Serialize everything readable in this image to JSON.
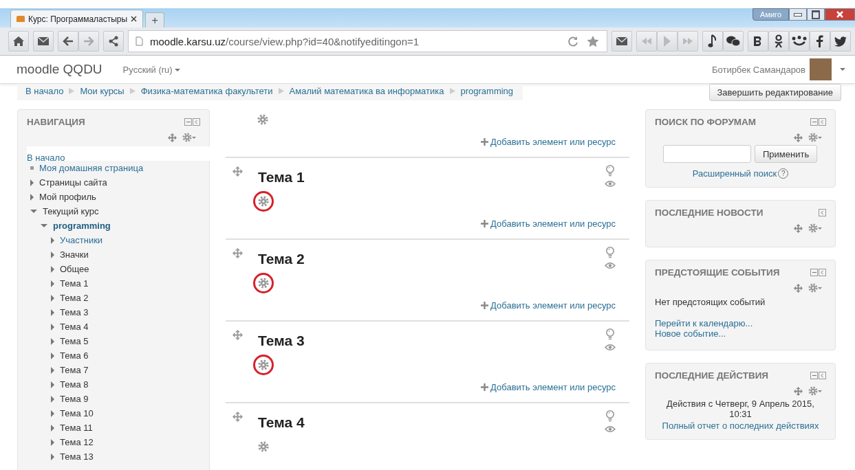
{
  "browser": {
    "tab_title": "Курс: Программаластыры",
    "new_tab": "+",
    "profile_button": "Амиго",
    "url_host": "moodle.karsu.uz",
    "url_path": "/course/view.php?id=40&notifyeditingon=1"
  },
  "header": {
    "brand": "moodle QQDU",
    "language": "Русский (ru)",
    "user_name": "Ботирбек Самандаров"
  },
  "breadcrumb": [
    "В начало",
    "Мои курсы",
    "Физика-математика факультети",
    "Амалий математика ва информатика",
    "programming"
  ],
  "edit_button": "Завершить редактирование",
  "navigation": {
    "title": "НАВИГАЦИЯ",
    "items": [
      {
        "label": "В начало",
        "kind": "root",
        "link": true
      },
      {
        "label": "Моя домашняя страница",
        "kind": "leaf",
        "link": true
      },
      {
        "label": "Страницы сайта",
        "kind": "branch",
        "link": false,
        "expanded": false
      },
      {
        "label": "Мой профиль",
        "kind": "branch",
        "link": false,
        "expanded": false
      },
      {
        "label": "Текущий курс",
        "kind": "branch",
        "link": false,
        "expanded": true,
        "children": [
          {
            "label": "programming",
            "kind": "course",
            "link": true,
            "expanded": true,
            "children": [
              {
                "label": "Участники",
                "kind": "branch",
                "link": true,
                "expanded": false
              },
              {
                "label": "Значки",
                "kind": "branch",
                "link": false,
                "expanded": false
              },
              {
                "label": "Общее",
                "kind": "branch",
                "link": false,
                "expanded": false
              },
              {
                "label": "Тема 1",
                "kind": "branch",
                "link": false,
                "expanded": false
              },
              {
                "label": "Тема 2",
                "kind": "branch",
                "link": false,
                "expanded": false
              },
              {
                "label": "Тема 3",
                "kind": "branch",
                "link": false,
                "expanded": false
              },
              {
                "label": "Тема 4",
                "kind": "branch",
                "link": false,
                "expanded": false
              },
              {
                "label": "Тема 5",
                "kind": "branch",
                "link": false,
                "expanded": false
              },
              {
                "label": "Тема 6",
                "kind": "branch",
                "link": false,
                "expanded": false
              },
              {
                "label": "Тема 7",
                "kind": "branch",
                "link": false,
                "expanded": false
              },
              {
                "label": "Тема 8",
                "kind": "branch",
                "link": false,
                "expanded": false
              },
              {
                "label": "Тема 9",
                "kind": "branch",
                "link": false,
                "expanded": false
              },
              {
                "label": "Тема 10",
                "kind": "branch",
                "link": false,
                "expanded": false
              },
              {
                "label": "Тема 11",
                "kind": "branch",
                "link": false,
                "expanded": false
              },
              {
                "label": "Тема 12",
                "kind": "branch",
                "link": false,
                "expanded": false
              },
              {
                "label": "Тема 13",
                "kind": "branch",
                "link": false,
                "expanded": false
              }
            ]
          }
        ]
      }
    ]
  },
  "sections": [
    {
      "add_link": "Добавить элемент или ресурс",
      "highlighted": false
    },
    {
      "title": "Тема 1",
      "add_link": "Добавить элемент или ресурс",
      "highlighted": true
    },
    {
      "title": "Тема 2",
      "add_link": "Добавить элемент или ресурс",
      "highlighted": true
    },
    {
      "title": "Тема 3",
      "add_link": "Добавить элемент или ресурс",
      "highlighted": true
    },
    {
      "title": "Тема 4",
      "highlighted": false
    }
  ],
  "blocks": [
    {
      "kind": "search",
      "title": "ПОИСК ПО ФОРУМАМ",
      "collapsible": true,
      "button": "Применить",
      "link": "Расширенный поиск",
      "help": "?"
    },
    {
      "kind": "empty",
      "title": "ПОСЛЕДНИЕ НОВОСТИ",
      "collapsible": false
    },
    {
      "kind": "events",
      "title": "ПРЕДСТОЯЩИЕ СОБЫТИЯ",
      "collapsible": true,
      "text": "Нет предстоящих событий",
      "links": [
        "Перейти к календарю...",
        "Новое событие..."
      ]
    },
    {
      "kind": "activity",
      "title": "ПОСЛЕДНИЕ ДЕЙСТВИЯ",
      "collapsible": true,
      "text": "Действия с Четверг, 9 Апрель 2015, 10:31",
      "link": "Полный отчет о последних действиях"
    }
  ]
}
